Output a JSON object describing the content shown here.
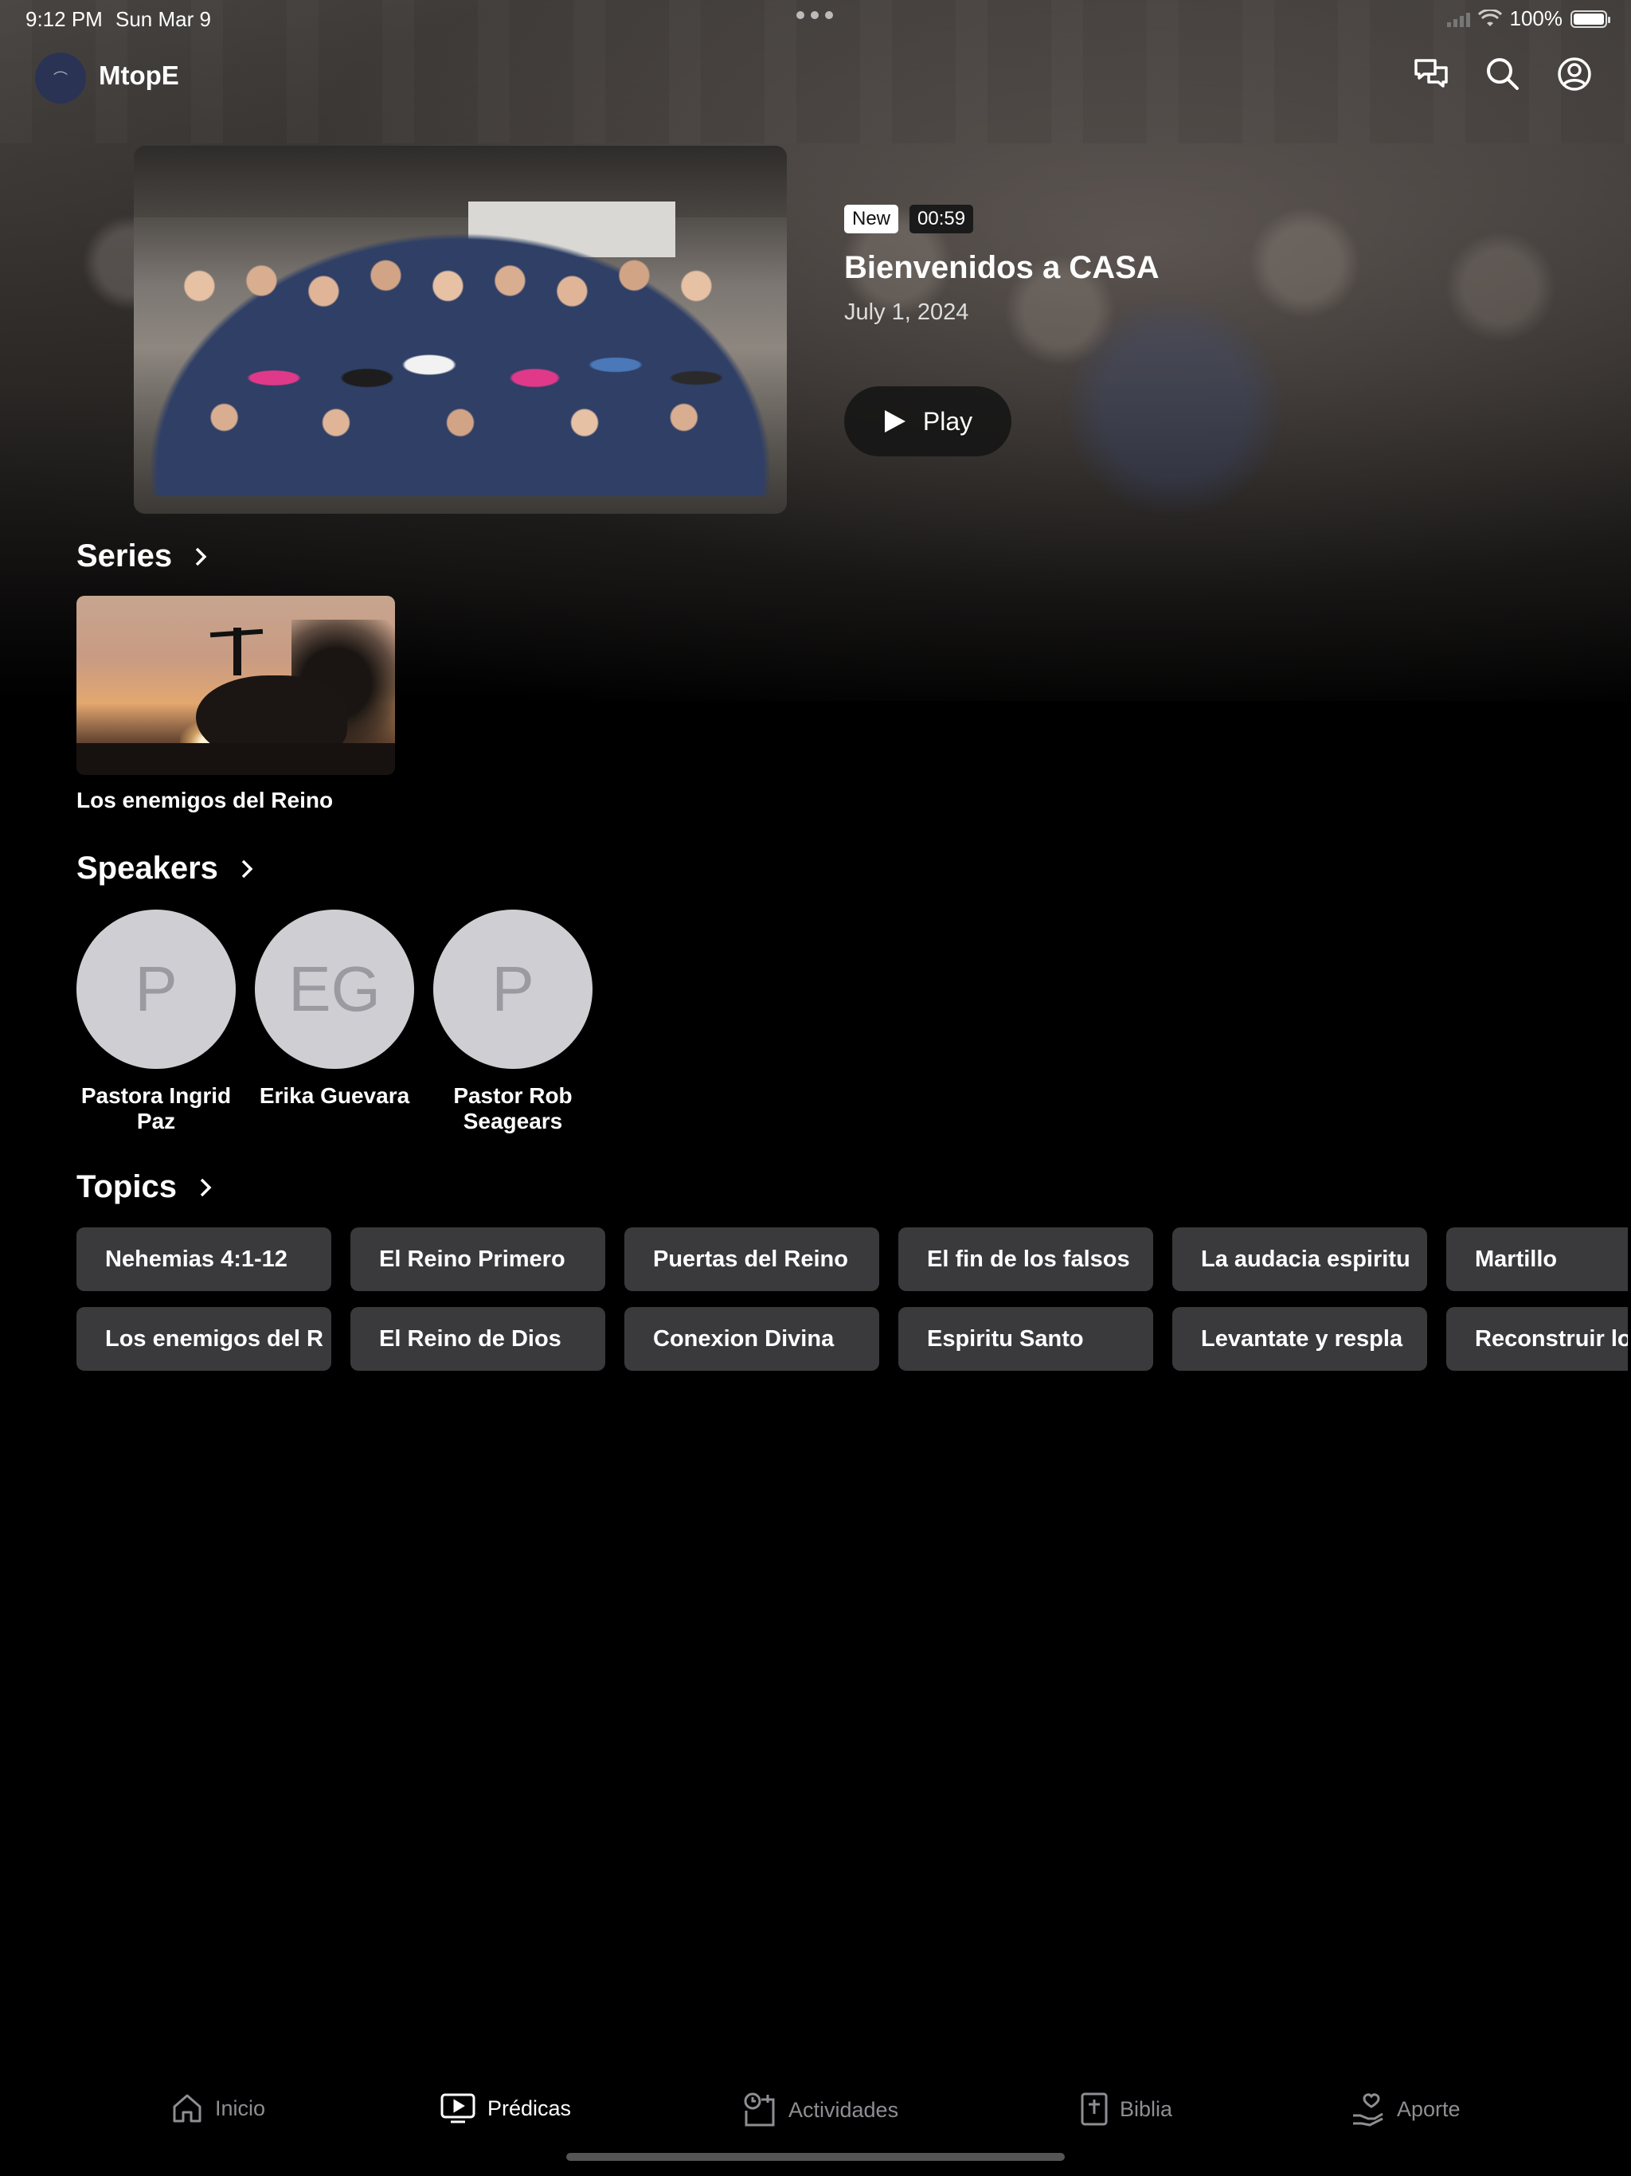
{
  "status_bar": {
    "time": "9:12 PM",
    "date": "Sun Mar 9",
    "battery": "100%"
  },
  "header": {
    "app_name": "MtopE",
    "icons": [
      "chat-icon",
      "search-icon",
      "account-icon"
    ]
  },
  "featured": {
    "badge_new": "New",
    "duration": "00:59",
    "title": "Bienvenidos a CASA",
    "date": "July 1, 2024",
    "play_label": "Play"
  },
  "series": {
    "heading": "Series",
    "items": [
      {
        "title": "Los enemigos del Reino"
      }
    ]
  },
  "speakers": {
    "heading": "Speakers",
    "items": [
      {
        "initials": "P",
        "name": "Pastora Ingrid Paz"
      },
      {
        "initials": "EG",
        "name": "Erika Guevara"
      },
      {
        "initials": "P",
        "name": "Pastor Rob Seagears"
      }
    ]
  },
  "topics": {
    "heading": "Topics",
    "row1": [
      "Nehemias 4:1-12",
      "El Reino Primero",
      "Puertas del Reino",
      "El fin de los falsos",
      "La audacia espiritu",
      "Martillo"
    ],
    "row2": [
      "Los enemigos del R",
      "El Reino de Dios",
      "Conexion Divina",
      "Espiritu Santo",
      "Levantate y respla",
      "Reconstruir los"
    ]
  },
  "tabs": [
    {
      "label": "Inicio",
      "icon": "home-icon",
      "active": false
    },
    {
      "label": "Prédicas",
      "icon": "tv-icon",
      "active": true
    },
    {
      "label": "Actividades",
      "icon": "calendar-clock-icon",
      "active": false
    },
    {
      "label": "Biblia",
      "icon": "bible-icon",
      "active": false
    },
    {
      "label": "Aporte",
      "icon": "give-heart-icon",
      "active": false
    }
  ],
  "colors": {
    "background": "#000000",
    "chip": "#3a3a3c",
    "inactive_tab": "#8e8e93",
    "avatar_bg": "#cfcfd3"
  }
}
